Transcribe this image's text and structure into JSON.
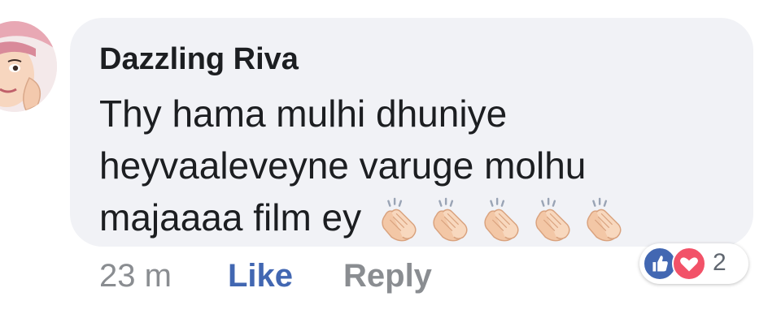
{
  "comment": {
    "author": "Dazzling Riva",
    "text_lines": [
      "Thy hama mulhi dhuniye",
      "heyvaaleveyne varuge molhu",
      "majaaaa film ey"
    ],
    "emoji": "clapping-hands",
    "emoji_count": 5
  },
  "actions": {
    "timestamp": "23 m",
    "like_label": "Like",
    "reply_label": "Reply"
  },
  "reactions": {
    "types": [
      "like",
      "love"
    ],
    "count": "2"
  },
  "colors": {
    "bubble": "#f1f2f6",
    "link": "#4267b2",
    "muted": "#8a8d91",
    "like_badge": "#4267b2",
    "love_badge": "#f25268"
  }
}
